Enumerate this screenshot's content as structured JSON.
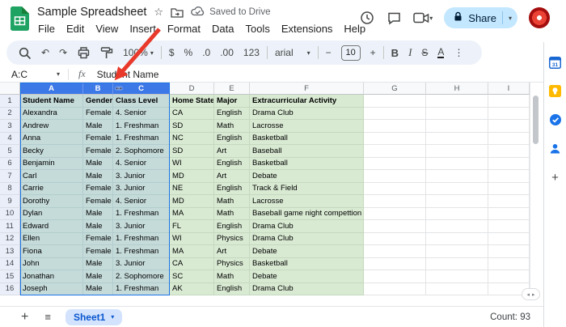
{
  "top": {
    "title": "Sample Spreadsheet",
    "saved": "Saved to Drive",
    "share": "Share",
    "menu": [
      "File",
      "Edit",
      "View",
      "Insert",
      "Format",
      "Data",
      "Tools",
      "Extensions",
      "Help"
    ]
  },
  "toolbar": {
    "zoom": "100%",
    "currency": "$",
    "percent": "%",
    "decimal_decrease": ".0",
    "decimal_increase": ".00",
    "number_format": "123",
    "font": "arial",
    "font_size": "10",
    "bold": "B",
    "italic": "I",
    "strikethrough": "S",
    "text_color": "A"
  },
  "formula_bar": {
    "name_box": "A:C",
    "fx": "fx",
    "value": "Student Name"
  },
  "grid": {
    "col_letters": [
      "A",
      "B",
      "C",
      "D",
      "E",
      "F",
      "G",
      "H",
      "I"
    ],
    "selected_columns": [
      "A",
      "B",
      "C"
    ],
    "rows": [
      [
        "Student Name",
        "Gender",
        "Class Level",
        "Home State",
        "Major",
        "Extracurricular Activity"
      ],
      [
        "Alexandra",
        "Female",
        "4. Senior",
        "CA",
        "English",
        "Drama Club"
      ],
      [
        "Andrew",
        "Male",
        "1. Freshman",
        "SD",
        "Math",
        "Lacrosse"
      ],
      [
        "Anna",
        "Female",
        "1. Freshman",
        "NC",
        "English",
        "Basketball"
      ],
      [
        "Becky",
        "Female",
        "2. Sophomore",
        "SD",
        "Art",
        "Baseball"
      ],
      [
        "Benjamin",
        "Male",
        "4. Senior",
        "WI",
        "English",
        "Basketball"
      ],
      [
        "Carl",
        "Male",
        "3. Junior",
        "MD",
        "Art",
        "Debate"
      ],
      [
        "Carrie",
        "Female",
        "3. Junior",
        "NE",
        "English",
        "Track & Field"
      ],
      [
        "Dorothy",
        "Female",
        "4. Senior",
        "MD",
        "Math",
        "Lacrosse"
      ],
      [
        "Dylan",
        "Male",
        "1. Freshman",
        "MA",
        "Math",
        "Baseball game night compettion"
      ],
      [
        "Edward",
        "Male",
        "3. Junior",
        "FL",
        "English",
        "Drama Club"
      ],
      [
        "Ellen",
        "Female",
        "1. Freshman",
        "WI",
        "Physics",
        "Drama Club"
      ],
      [
        "Fiona",
        "Female",
        "1. Freshman",
        "MA",
        "Art",
        "Debate"
      ],
      [
        "John",
        "Male",
        "3. Junior",
        "CA",
        "Physics",
        "Basketball"
      ],
      [
        "Jonathan",
        "Male",
        "2. Sophomore",
        "SC",
        "Math",
        "Debate"
      ],
      [
        "Joseph",
        "Male",
        "1. Freshman",
        "AK",
        "English",
        "Drama Club"
      ]
    ]
  },
  "sheet_bar": {
    "sheet_name": "Sheet1",
    "count": "Count: 93"
  },
  "sidebar": {
    "calendar": "31"
  },
  "icons": {
    "caret": "▾",
    "star": "☆",
    "undo": "↶",
    "redo": "↷",
    "more": "⋮",
    "minus": "−",
    "plus": "+",
    "add": "+",
    "all_sheets": "≡",
    "scroll_left": "◂",
    "scroll_right": "▸",
    "resize": "↔"
  }
}
